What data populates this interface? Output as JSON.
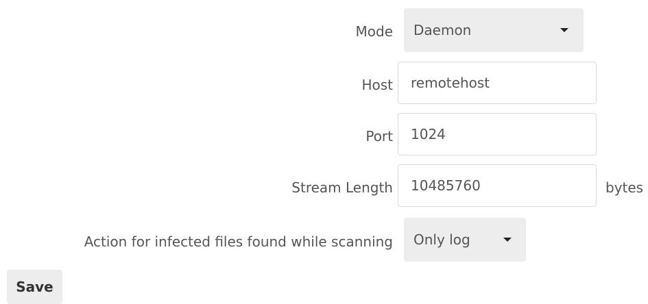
{
  "form": {
    "mode": {
      "label": "Mode",
      "value": "Daemon"
    },
    "host": {
      "label": "Host",
      "value": "remotehost"
    },
    "port": {
      "label": "Port",
      "value": "1024"
    },
    "stream_length": {
      "label": "Stream Length",
      "value": "10485760",
      "unit": "bytes"
    },
    "infected_action": {
      "label": "Action for infected files found while scanning",
      "value": "Only log"
    },
    "save_label": "Save"
  },
  "icons": {
    "dropdown": "caret-down-icon"
  }
}
